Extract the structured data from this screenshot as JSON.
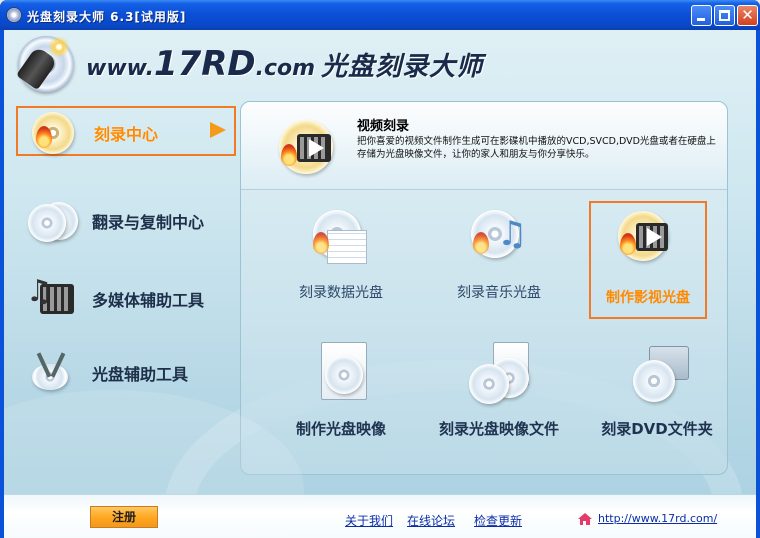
{
  "window": {
    "title": "光盘刻录大师 6.3[试用版]"
  },
  "header": {
    "brand_www": "www.",
    "brand_num": "17RD",
    "brand_com": ".com",
    "brand_cn": "光盘刻录大师"
  },
  "sidebar": {
    "items": [
      {
        "label": "刻录中心",
        "icon": "burn-disc-icon",
        "active": true
      },
      {
        "label": "翻录与复制中心",
        "icon": "copy-discs-icon",
        "active": false
      },
      {
        "label": "多媒体辅助工具",
        "icon": "multimedia-icon",
        "active": false
      },
      {
        "label": "光盘辅助工具",
        "icon": "disc-tools-icon",
        "active": false
      }
    ]
  },
  "panel": {
    "title": "视频刻录",
    "description": "把你喜爱的视频文件制作生成可在影碟机中播放的VCD,SVCD,DVD光盘或者在硬盘上存储为光盘映像文件，让你的家人和朋友与你分享快乐。",
    "tools": [
      {
        "label": "刻录数据光盘",
        "icon": "data-disc-icon"
      },
      {
        "label": "刻录音乐光盘",
        "icon": "music-disc-icon"
      },
      {
        "label": "制作影视光盘",
        "icon": "video-disc-icon",
        "selected": true
      },
      {
        "label": "制作光盘映像",
        "icon": "disc-image-icon"
      },
      {
        "label": "刻录光盘映像文件",
        "icon": "burn-image-file-icon"
      },
      {
        "label": "刻录DVD文件夹",
        "icon": "dvd-folder-icon"
      }
    ]
  },
  "footer": {
    "register": "注册",
    "about": "关于我们",
    "forum": "在线论坛",
    "update": "检查更新",
    "website": "http://www.17rd.com/"
  },
  "colors": {
    "accent": "#f07a26",
    "active_text": "#ff8a00",
    "link": "#0b2ea8",
    "titlebar": "#0a4fd6"
  }
}
